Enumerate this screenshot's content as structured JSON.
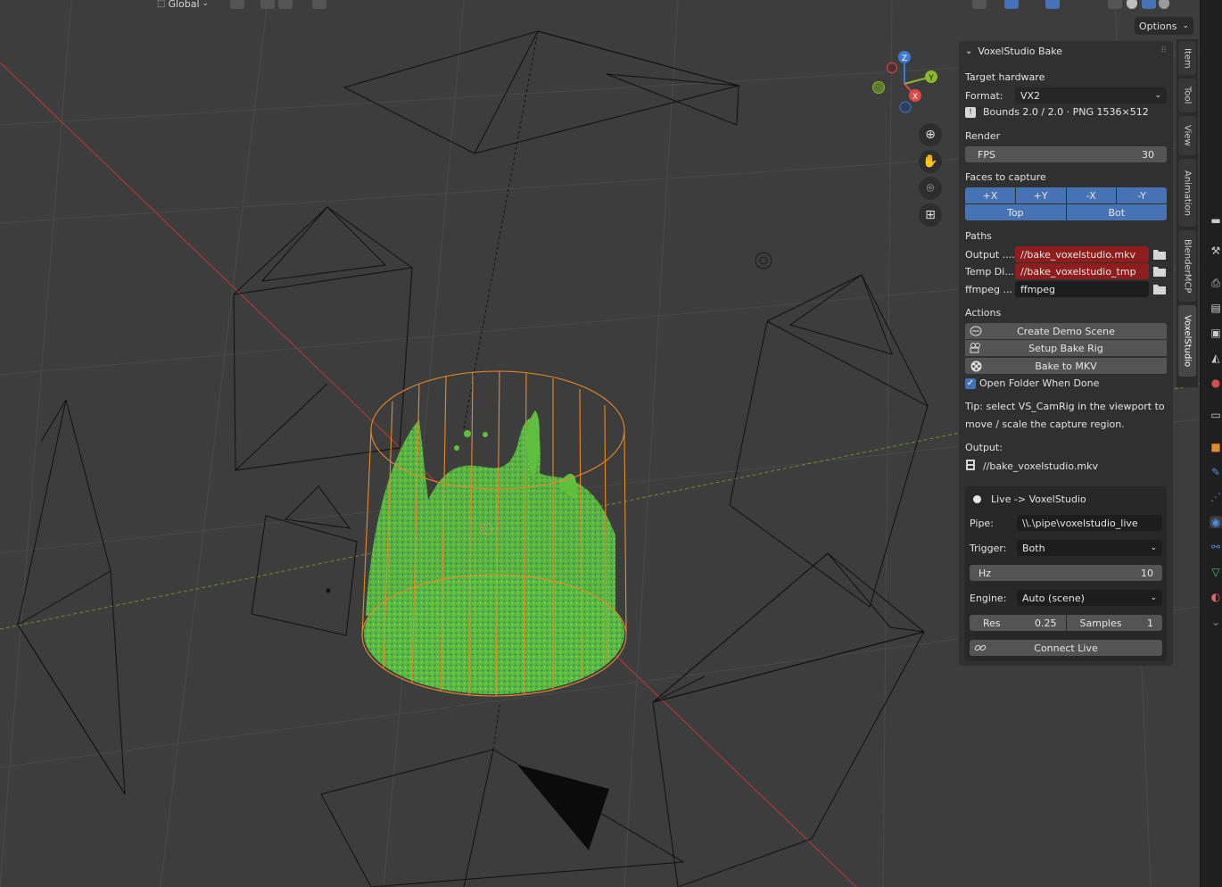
{
  "header": {
    "orientation": "Global",
    "toolbar_icons": [
      "transform-pivot-icon",
      "snap-icon",
      "snap-increment-icon",
      "proportional-edit-icon",
      "falloff-icon",
      "gizmo-icon",
      "overlay-icon",
      "xray-icon",
      "shading-wireframe-icon",
      "shading-solid-icon",
      "shading-material-icon",
      "shading-rendered-icon"
    ]
  },
  "viewport": {
    "options_label": "Options",
    "gizmo": {
      "z": "Z",
      "y": "Y",
      "x": "X"
    },
    "nav_tools": [
      "zoom-icon",
      "hand-pan-icon",
      "camera-view-icon",
      "grid-perspective-icon"
    ]
  },
  "panel": {
    "title": "VoxelStudio Bake",
    "target_hardware_label": "Target hardware",
    "format_label": "Format:",
    "format_value": "VX2",
    "bounds_info": "Bounds 2.0 / 2.0  ·  PNG 1536×512",
    "render_label": "Render",
    "fps_label": "FPS",
    "fps_value": "30",
    "faces_label": "Faces to capture",
    "faces_row1": [
      "+X",
      "+Y",
      "-X",
      "-Y"
    ],
    "faces_row2": [
      "Top",
      "Bot"
    ],
    "paths_label": "Paths",
    "output_label": "Output ....",
    "output_value": "//bake_voxelstudio.mkv",
    "temp_label": "Temp Di...",
    "temp_value": "//bake_voxelstudio_tmp",
    "ffmpeg_label": "ffmpeg ...",
    "ffmpeg_value": "ffmpeg",
    "actions_label": "Actions",
    "create_demo": "Create Demo Scene",
    "setup_rig": "Setup Bake Rig",
    "bake_mkv": "Bake to MKV",
    "open_folder": "Open Folder When Done",
    "open_folder_checked": true,
    "tip_line1": "Tip: select VS_CamRig in the viewport to",
    "tip_line2": "move / scale the capture region.",
    "output_heading": "Output:",
    "output_path": "//bake_voxelstudio.mkv"
  },
  "live": {
    "title": "Live -> VoxelStudio",
    "pipe_label": "Pipe:",
    "pipe_value": "\\\\.\\pipe\\voxelstudio_live",
    "trigger_label": "Trigger:",
    "trigger_value": "Both",
    "hz_label": "Hz",
    "hz_value": "10",
    "engine_label": "Engine:",
    "engine_value": "Auto (scene)",
    "res_label": "Res",
    "res_value": "0.25",
    "samples_label": "Samples",
    "samples_value": "1",
    "connect_label": "Connect Live"
  },
  "side_tabs": [
    {
      "label": "Item",
      "active": false
    },
    {
      "label": "Tool",
      "active": false
    },
    {
      "label": "View",
      "active": false
    },
    {
      "label": "Animation",
      "active": false
    },
    {
      "label": "BlenderMCP",
      "active": false
    },
    {
      "label": "VoxelStudio",
      "active": true
    }
  ],
  "colors": {
    "accent_blue": "#4772b3",
    "path_red": "#8e1d1d",
    "selection_orange": "#f0902a",
    "fluid_green": "#5fbf3f",
    "panel_bg": "#303030",
    "viewport_bg": "#3d3d3d"
  }
}
